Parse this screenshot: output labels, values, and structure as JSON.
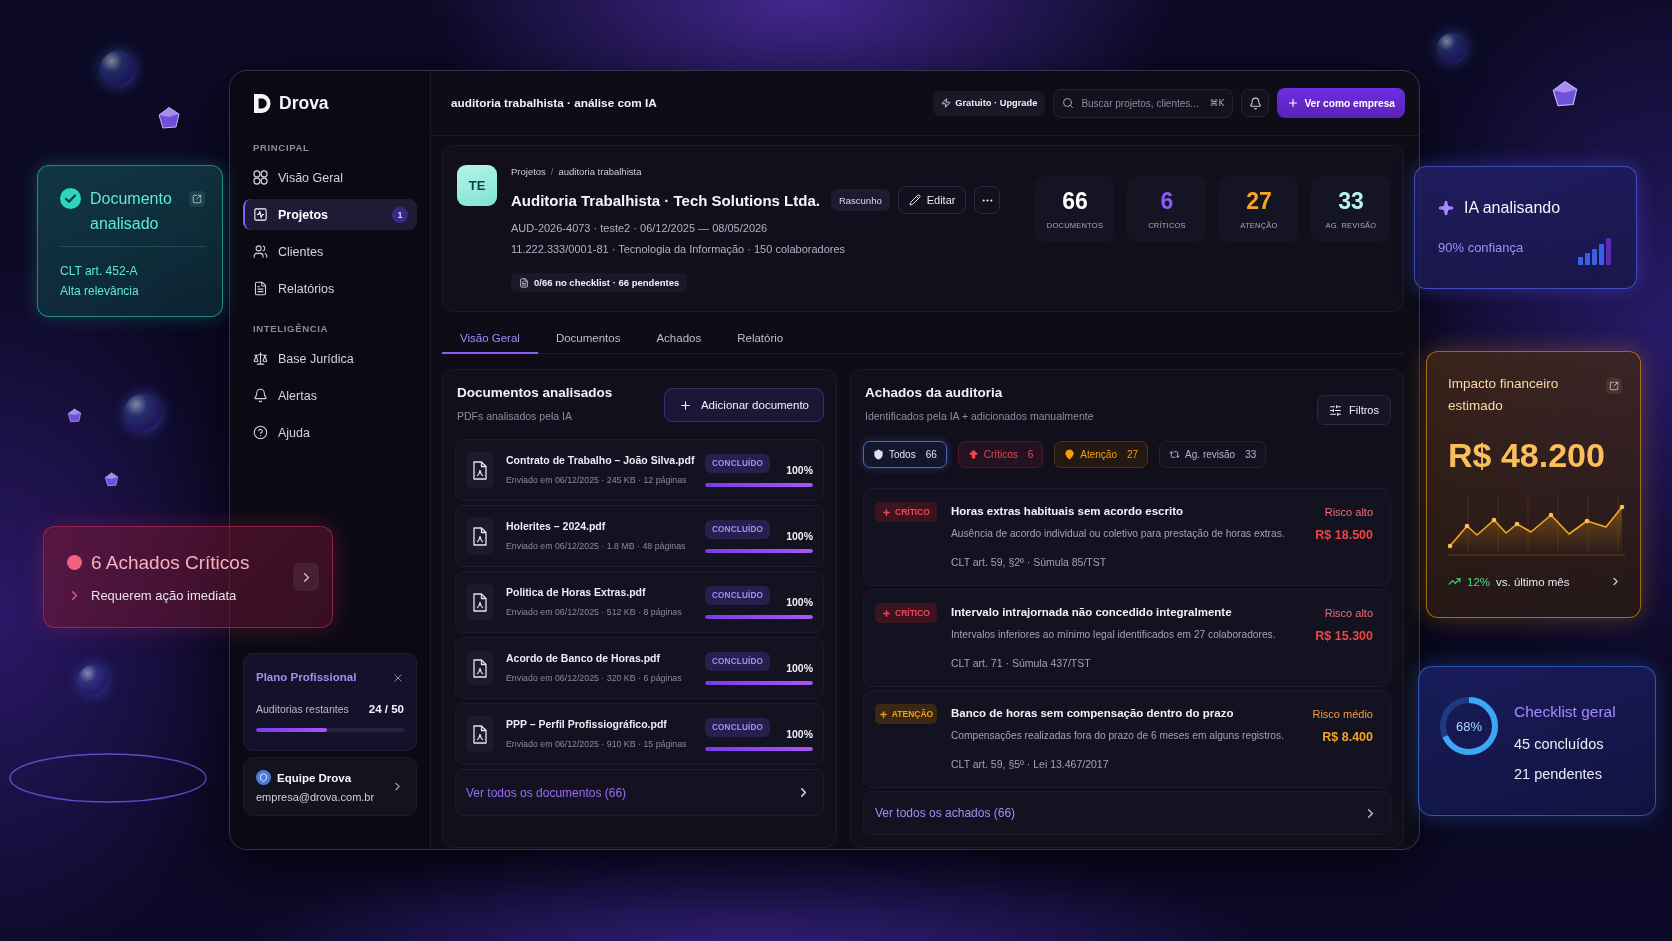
{
  "sidebar": {
    "brand": "Drova",
    "sections": [
      {
        "heading": "PRINCIPAL",
        "items": [
          {
            "label": "Visão Geral",
            "selected": false
          },
          {
            "label": "Projetos",
            "selected": true,
            "badge": "1"
          },
          {
            "label": "Clientes",
            "selected": false
          },
          {
            "label": "Relatórios",
            "selected": false
          }
        ]
      },
      {
        "heading": "INTELIGÊNCIA",
        "items": [
          {
            "label": "Base Jurídica",
            "selected": false
          },
          {
            "label": "Alertas",
            "selected": false
          },
          {
            "label": "Ajuda",
            "selected": false
          }
        ]
      }
    ],
    "plan": {
      "title": "Plano Profissional",
      "label": "Auditorias restantes",
      "count": "24 / 50",
      "level": 0.48
    },
    "account": {
      "name": "Equipe Drova",
      "email": "empresa@drova.com.br"
    }
  },
  "header": {
    "title": "auditoria trabalhista · análise com IA",
    "plan_chip": "Gratuito · Upgrade",
    "search": {
      "placeholder": "Buscar projetos, clientes...",
      "shortcut": "⌘K"
    },
    "action": "Ver como empresa"
  },
  "project": {
    "avatar": "TE",
    "breadcrumb": [
      "Projetos",
      "auditoria trabalhista"
    ],
    "breadcrumb_separator": "/",
    "title": "Auditoria Trabalhista · Tech Solutions Ltda.",
    "status": "Rascunho",
    "edit": "Editar",
    "meta": [
      "AUD-2026-4073 · teste2 · 06/12/2025 — 08/05/2026",
      "11.222.333/0001-81 · Tecnologia da Informação · 150 colaboradores"
    ],
    "checklist": "0/66 no checklist · 66 pendentes",
    "stats": [
      {
        "value": "66",
        "label": "DOCUMENTOS",
        "color": "#ffffff"
      },
      {
        "value": "6",
        "label": "CRÍTICOS",
        "color": "#8b5cf6"
      },
      {
        "value": "27",
        "label": "ATENÇÃO",
        "color": "#f5a524"
      },
      {
        "value": "33",
        "label": "AG. REVISÃO",
        "color": "#b9f3f0"
      }
    ]
  },
  "tabs": [
    {
      "label": "Visão Geral",
      "selected": true
    },
    {
      "label": "Documentos",
      "selected": false
    },
    {
      "label": "Achados",
      "selected": false
    },
    {
      "label": "Relatório",
      "selected": false
    }
  ],
  "documents": {
    "title": "Documentos analisados",
    "subtitle": "PDFs analisados pela IA",
    "add_button": "Adicionar documento",
    "items": [
      {
        "name": "Contrato de Trabalho – João Silva.pdf",
        "meta": "Enviado em 06/12/2025 · 245 KB · 12 páginas",
        "status": "CONCLUÍDO",
        "percent": "100%",
        "level": 1
      },
      {
        "name": "Holerites – 2024.pdf",
        "meta": "Enviado em 06/12/2025 · 1.8 MB · 48 páginas",
        "status": "CONCLUÍDO",
        "percent": "100%",
        "level": 1
      },
      {
        "name": "Politica de Horas Extras.pdf",
        "meta": "Enviado em 06/12/2025 · 512 KB · 8 páginas",
        "status": "CONCLUÍDO",
        "percent": "100%",
        "level": 1
      },
      {
        "name": "Acordo de Banco de Horas.pdf",
        "meta": "Enviado em 06/12/2025 · 320 KB · 6 páginas",
        "status": "CONCLUÍDO",
        "percent": "100%",
        "level": 1
      },
      {
        "name": "PPP – Perfil Profissiográfico.pdf",
        "meta": "Enviado em 06/12/2025 · 910 KB · 15 páginas",
        "status": "CONCLUÍDO",
        "percent": "100%",
        "level": 1
      }
    ],
    "view_all": "Ver todos os documentos (66)"
  },
  "findings": {
    "title": "Achados da auditoria",
    "subtitle": "Identificados pela IA + adicionados manualmente",
    "filter_button": "Filtros",
    "filters": [
      {
        "kind": "all",
        "label": "Todos",
        "count": "66",
        "selected": true
      },
      {
        "kind": "critical",
        "label": "Críticos",
        "count": "6",
        "selected": false
      },
      {
        "kind": "attention",
        "label": "Atenção",
        "count": "27",
        "selected": false
      },
      {
        "kind": "review",
        "label": "Ag. revisão",
        "count": "33",
        "selected": false
      }
    ],
    "items": [
      {
        "kind": "critical",
        "tag": "CRÍTICO",
        "title": "Horas extras habituais sem acordo escrito",
        "description": "Ausência de acordo individual ou coletivo para prestação de horas extras.",
        "reference": "CLT art. 59, §2º · Súmula 85/TST",
        "risk": "Risco alto",
        "amount": "R$ 18.500"
      },
      {
        "kind": "critical",
        "tag": "CRÍTICO",
        "title": "Intervalo intrajornada não concedido integralmente",
        "description": "Intervalos inferiores ao mínimo legal identificados em 27 colaboradores.",
        "reference": "CLT art. 71 · Súmula 437/TST",
        "risk": "Risco alto",
        "amount": "R$ 15.300"
      },
      {
        "kind": "attention",
        "tag": "ATENÇÃO",
        "title": "Banco de horas sem compensação dentro do prazo",
        "description": "Compensações realizadas fora do prazo de 6 meses em alguns registros.",
        "reference": "CLT art. 59, §5º · Lei 13.467/2017",
        "risk": "Risco médio",
        "amount": "R$ 8.400"
      }
    ],
    "view_all": "Ver todos os achados (66)"
  },
  "overlays": {
    "document_toast": {
      "title": "Documento analisado",
      "reference": "CLT art. 452-A",
      "note": "Alta relevância"
    },
    "critical_alert": {
      "title": "6 Achados Críticos",
      "subtitle": "Requerem ação imediata"
    },
    "ai_status": {
      "title": "IA analisando",
      "confidence": "90% confiança"
    },
    "impact": {
      "title": "Impacto financeiro estimado",
      "amount": "R$ 48.200",
      "change": "12%",
      "comparison": "vs. último mês"
    },
    "checklist": {
      "percent": "68%",
      "level": 0.68,
      "title": "Checklist geral",
      "done": "45 concluídos",
      "pending": "21 pendentes"
    }
  }
}
